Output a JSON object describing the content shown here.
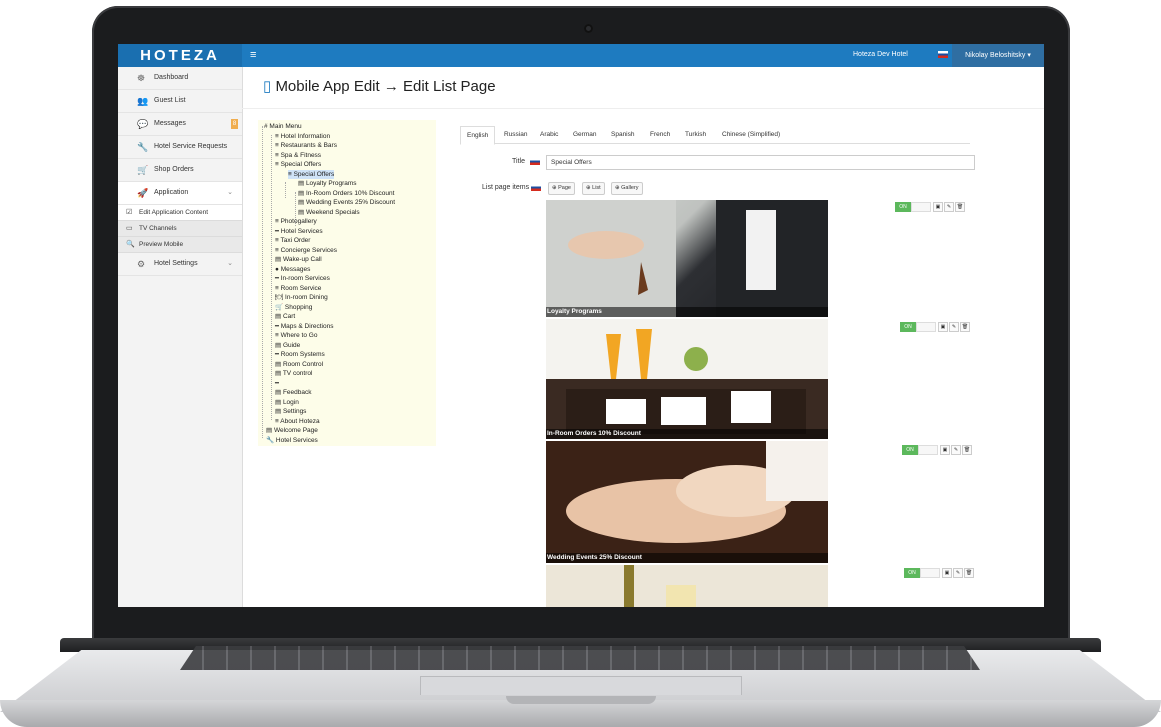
{
  "brand": "HOTEZA",
  "topbar": {
    "menu_icon": "≡",
    "hotel": "Hoteza Dev Hotel",
    "user": "Nikolay Beloshitsky ▾"
  },
  "sidebar": {
    "items": [
      {
        "icon": "☸",
        "label": "Dashboard"
      },
      {
        "icon": "👥",
        "label": "Guest List"
      },
      {
        "icon": "💬",
        "label": "Messages",
        "badge": "8"
      },
      {
        "icon": "🔧",
        "label": "Hotel Service Requests"
      },
      {
        "icon": "🛒",
        "label": "Shop Orders"
      },
      {
        "icon": "🚀",
        "label": "Application",
        "chevron": "⌄"
      }
    ],
    "sub_items": [
      {
        "icon": "☑",
        "label": "Edit Application Content"
      },
      {
        "icon": "▭",
        "label": "TV Channels"
      },
      {
        "icon": "🔍",
        "label": "Preview Mobile"
      }
    ],
    "settings": {
      "icon": "⚙",
      "label": "Hotel Settings",
      "chevron": "⌄"
    }
  },
  "page": {
    "icon": "▯",
    "title": "Mobile App Edit → Edit List Page"
  },
  "tree": [
    "# Main Menu",
    "≡ Hotel Information",
    "≡ Restaurants & Bars",
    "≡ Spa & Fitness",
    "≡ Special Offers",
    "≡ Special Offers",
    "▤ Loyalty Programs",
    "▤ In-Room Orders 10% Discount",
    "▤ Wedding Events 25% Discount",
    "▤ Weekend Specials",
    "≡ Photogallery",
    "━ Hotel Services",
    "≡ Taxi Order",
    "≡ Concierge Services",
    "▤ Wake-up Call",
    "● Messages",
    "━ In-room Services",
    "≡ Room Service",
    "🍽 In-room Dining",
    "🛒 Shopping",
    "▤ Cart",
    "━ Maps & Directions",
    "≡ Where to Go",
    "▤ Guide",
    "━ Room Systems",
    "▤ Room Control",
    "▤ TV control",
    "━",
    "▤ Feedback",
    "▤ Login",
    "▤ Settings",
    "≡ About Hoteza",
    "▤ Welcome Page",
    "🔧 Hotel Services"
  ],
  "tabs": [
    "English",
    "Russian",
    "Arabic",
    "German",
    "Spanish",
    "French",
    "Turkish",
    "Chinese (Simplified)"
  ],
  "form": {
    "title_label": "Title",
    "title_value": "Special Offers",
    "list_label": "List page items"
  },
  "add_buttons": [
    "⊕ Page",
    "⊕ List",
    "⊕ Gallery"
  ],
  "items": [
    {
      "caption": "Loyalty Programs",
      "status": "ON"
    },
    {
      "caption": "In-Room Orders 10% Discount",
      "status": "ON"
    },
    {
      "caption": "Wedding Events 25% Discount",
      "status": "ON"
    },
    {
      "caption": "",
      "status": "ON"
    }
  ],
  "item_actions": [
    "▣",
    "✎",
    "🗑"
  ],
  "colors": {
    "topbar": "#1e7bc0",
    "on_toggle": "#5cb85c",
    "tree_bg": "#fdfde9"
  }
}
